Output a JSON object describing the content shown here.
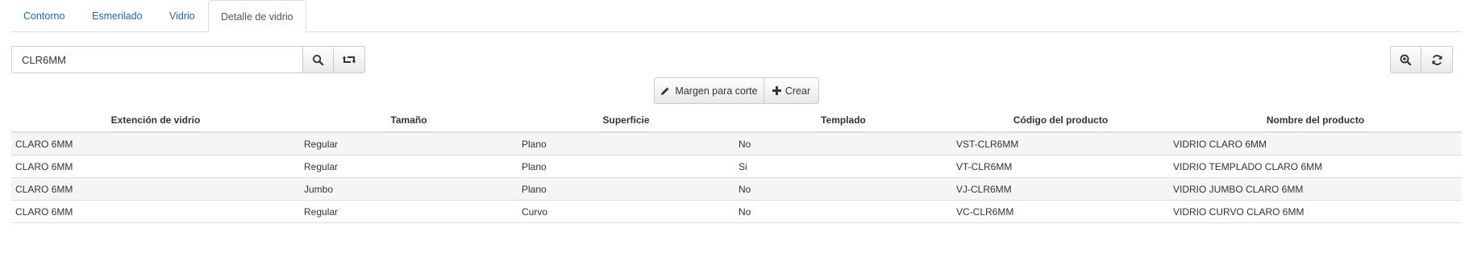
{
  "tabs": [
    {
      "label": "Contorno",
      "active": false
    },
    {
      "label": "Esmerilado",
      "active": false
    },
    {
      "label": "Vidrio",
      "active": false
    },
    {
      "label": "Detalle de vidrio",
      "active": true
    }
  ],
  "search": {
    "value": "CLR6MM"
  },
  "toolbar": {
    "search_icon": "search-icon",
    "reset_icon": "retweet-icon",
    "zoom_icon": "zoom-in-icon",
    "refresh_icon": "refresh-icon",
    "margin_label": "Margen para corte",
    "create_label": "Crear"
  },
  "table": {
    "columns": [
      "Extención de vidrio",
      "Tamaño",
      "Superficie",
      "Templado",
      "Código del producto",
      "Nombre del producto"
    ],
    "rows": [
      [
        "CLARO 6MM",
        "Regular",
        "Plano",
        "No",
        "VST-CLR6MM",
        "VIDRIO CLARO 6MM"
      ],
      [
        "CLARO 6MM",
        "Regular",
        "Plano",
        "Si",
        "VT-CLR6MM",
        "VIDRIO TEMPLADO CLARO 6MM"
      ],
      [
        "CLARO 6MM",
        "Jumbo",
        "Plano",
        "No",
        "VJ-CLR6MM",
        "VIDRIO JUMBO CLARO 6MM"
      ],
      [
        "CLARO 6MM",
        "Regular",
        "Curvo",
        "No",
        "VC-CLR6MM",
        "VIDRIO CURVO CLARO 6MM"
      ]
    ]
  },
  "colors": {
    "link": "#2a6496",
    "border": "#dddddd",
    "stripe": "#f5f5f5"
  }
}
